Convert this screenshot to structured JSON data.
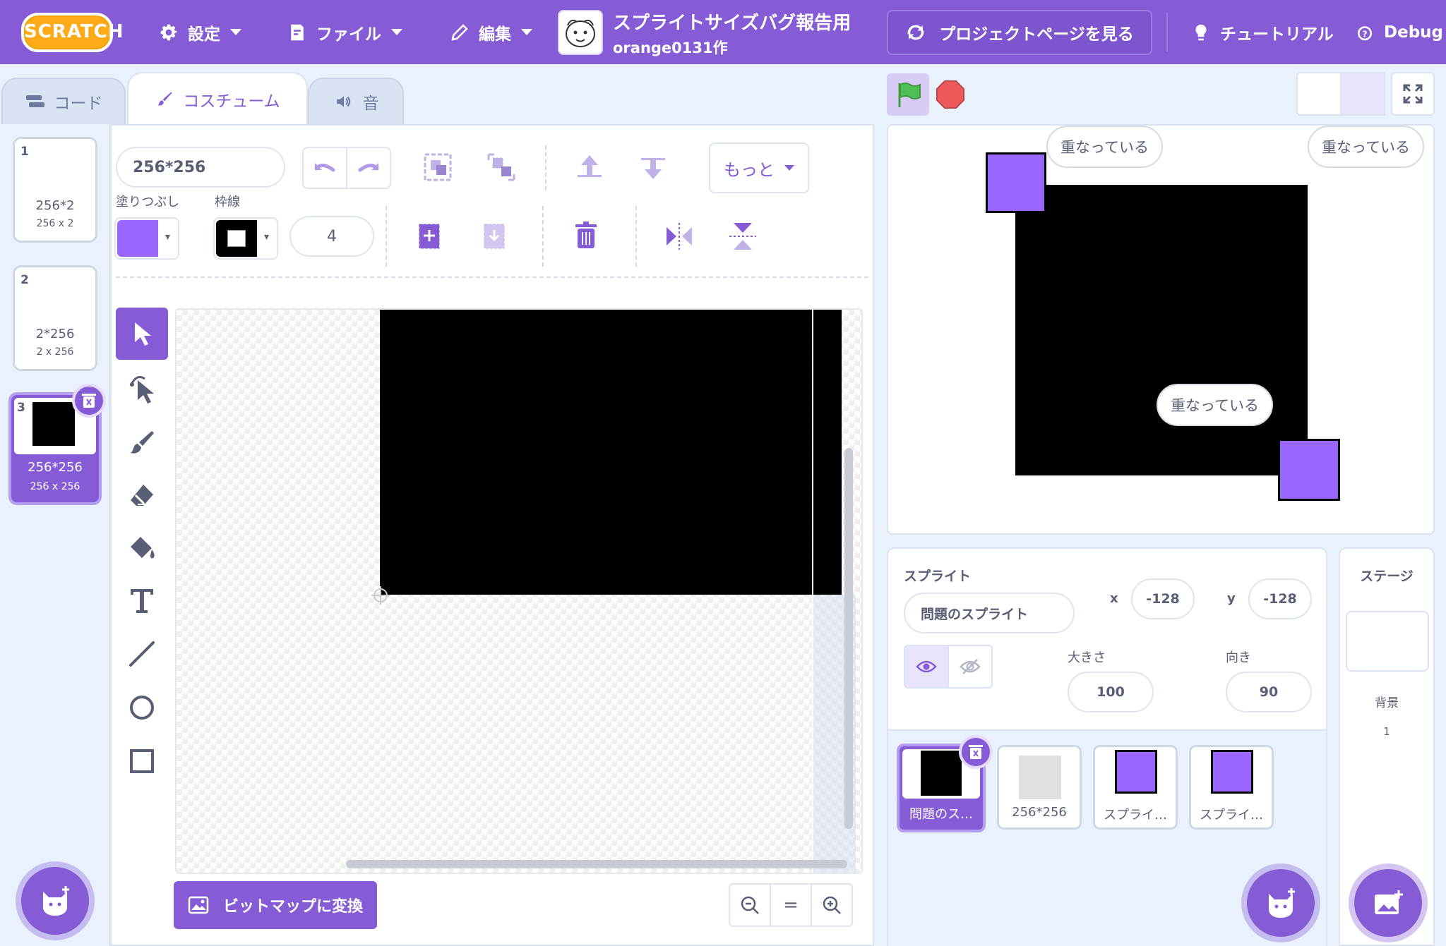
{
  "menubar": {
    "logo": "SCRATCH",
    "settings": "設定",
    "file": "ファイル",
    "edit": "編集",
    "project_title": "スプライトサイズバグ報告用",
    "project_author": "orange0131作",
    "project_page": "プロジェクトページを見る",
    "tutorial": "チュートリアル",
    "debug": "Debug"
  },
  "tabs": {
    "code": "コード",
    "costume": "コスチューム",
    "sound": "音"
  },
  "costumes": [
    {
      "num": "1",
      "name": "256*2",
      "size": "256 x 2"
    },
    {
      "num": "2",
      "name": "2*256",
      "size": "2 x 256"
    },
    {
      "num": "3",
      "name": "256*256",
      "size": "256 x 256"
    }
  ],
  "paint": {
    "costume_name": "256*256",
    "more": "もっと",
    "fill_label": "塗りつぶし",
    "outline_label": "枠線",
    "outline_width": "4",
    "fill_color": "#9966ff",
    "outline_color": "#000000",
    "bitmap_button": "ビットマップに変換",
    "zoom_reset": "="
  },
  "sprite_info": {
    "header": "スプライト",
    "name": "問題のスプライト",
    "x_label": "x",
    "x_value": "-128",
    "y_label": "y",
    "y_value": "-128",
    "size_label": "大きさ",
    "size_value": "100",
    "direction_label": "向き",
    "direction_value": "90"
  },
  "sprites": [
    {
      "name": "問題のス…"
    },
    {
      "name": "256*256"
    },
    {
      "name": "スプライ…"
    },
    {
      "name": "スプライ…"
    }
  ],
  "stage_panel": {
    "header": "ステージ",
    "backdrop_label": "背景",
    "backdrop_count": "1"
  },
  "stage": {
    "bubble_1": "重なっている",
    "bubble_2": "重なっている",
    "bubble_3": "重なっている"
  },
  "colors": {
    "accent": "#855cd6",
    "sprite_purple": "#9966ff",
    "flag_green": "#4cbf56",
    "stop_red": "#ec5959"
  }
}
